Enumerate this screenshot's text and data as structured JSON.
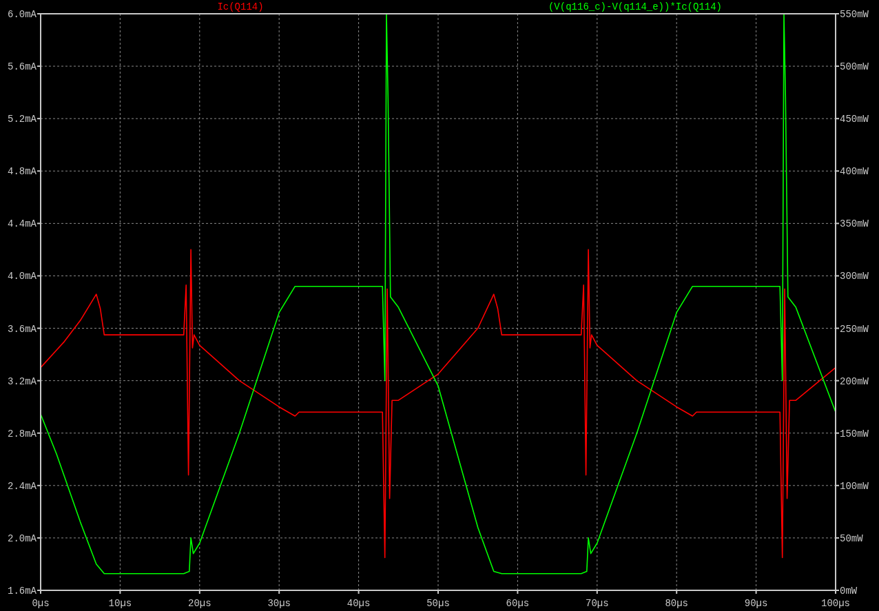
{
  "plot": {
    "charts": [
      {
        "chart_data": {
          "type": "line",
          "grid": true,
          "xlim": [
            0,
            100
          ],
          "ylim": [
            1.6,
            6.0
          ],
          "xticks": [
            {
              "value": 0,
              "label": "0µs"
            },
            {
              "value": 10,
              "label": "10µs"
            },
            {
              "value": 20,
              "label": "20µs"
            },
            {
              "value": 30,
              "label": "30µs"
            },
            {
              "value": 40,
              "label": "40µs"
            },
            {
              "value": 50,
              "label": "50µs"
            },
            {
              "value": 60,
              "label": "60µs"
            },
            {
              "value": 70,
              "label": "70µs"
            },
            {
              "value": 80,
              "label": "80µs"
            },
            {
              "value": 90,
              "label": "90µs"
            },
            {
              "value": 100,
              "label": "100µs"
            }
          ],
          "yticks": [
            {
              "value": 1.6,
              "label": "1.6mA"
            },
            {
              "value": 2.0,
              "label": "2.0mA"
            },
            {
              "value": 2.4,
              "label": "2.4mA"
            },
            {
              "value": 2.8,
              "label": "2.8mA"
            },
            {
              "value": 3.2,
              "label": "3.2mA"
            },
            {
              "value": 3.6,
              "label": "3.6mA"
            },
            {
              "value": 4.0,
              "label": "4.0mA"
            },
            {
              "value": 4.4,
              "label": "4.4mA"
            },
            {
              "value": 4.8,
              "label": "4.8mA"
            },
            {
              "value": 5.2,
              "label": "5.2mA"
            },
            {
              "value": 5.6,
              "label": "5.6mA"
            },
            {
              "value": 6.0,
              "label": "6.0mA"
            }
          ],
          "x": [
            0,
            3,
            5,
            7,
            7.5,
            8,
            10,
            18,
            18.3,
            18.6,
            18.9,
            19.1,
            19.3,
            20,
            25,
            30,
            32,
            32.5,
            40,
            43,
            43.3,
            43.6,
            43.9,
            44.2,
            45,
            50,
            55,
            57,
            57.5,
            58,
            68,
            68.3,
            68.6,
            68.9,
            69.1,
            69.3,
            70,
            75,
            80,
            82,
            82.5,
            90,
            93,
            93.3,
            93.6,
            93.9,
            94.2,
            95,
            100
          ],
          "series": [
            {
              "name": "Ic(Q114)",
              "color": "#ff0000",
              "values": [
                3.3,
                3.5,
                3.66,
                3.86,
                3.75,
                3.55,
                3.55,
                3.55,
                3.93,
                2.48,
                4.2,
                3.45,
                3.55,
                3.47,
                3.2,
                3.0,
                2.93,
                2.96,
                2.96,
                2.96,
                1.85,
                3.9,
                2.3,
                3.05,
                3.05,
                3.25,
                3.6,
                3.86,
                3.75,
                3.55,
                3.55,
                3.93,
                2.48,
                4.2,
                3.45,
                3.55,
                3.47,
                3.2,
                3.0,
                2.93,
                2.96,
                2.96,
                2.96,
                1.85,
                3.9,
                2.3,
                3.05,
                3.05,
                3.3
              ]
            }
          ]
        }
      },
      {
        "chart_data": {
          "type": "line",
          "xlim": [
            0,
            100
          ],
          "ylim": [
            0,
            550
          ],
          "yticks": [
            {
              "value": 0,
              "label": "0mW"
            },
            {
              "value": 50,
              "label": "50mW"
            },
            {
              "value": 100,
              "label": "100mW"
            },
            {
              "value": 150,
              "label": "150mW"
            },
            {
              "value": 200,
              "label": "200mW"
            },
            {
              "value": 250,
              "label": "250mW"
            },
            {
              "value": 300,
              "label": "300mW"
            },
            {
              "value": 350,
              "label": "350mW"
            },
            {
              "value": 400,
              "label": "400mW"
            },
            {
              "value": 450,
              "label": "450mW"
            },
            {
              "value": 500,
              "label": "500mW"
            },
            {
              "value": 550,
              "label": "550mW"
            }
          ],
          "x": [
            0,
            2,
            5,
            7,
            8,
            10,
            18,
            18.7,
            18.9,
            19.2,
            20,
            25,
            30,
            32,
            33,
            43,
            43.3,
            43.5,
            43.7,
            44,
            45,
            50,
            55,
            57,
            58,
            68,
            68.7,
            68.9,
            69.2,
            70,
            75,
            80,
            82,
            83,
            93,
            93.3,
            93.5,
            93.7,
            94,
            95,
            100
          ],
          "series": [
            {
              "name": "(V(q116_c)-V(q114_e))*Ic(Q114)",
              "color": "#00ff00",
              "values": [
                168,
                130,
                65,
                25,
                16,
                16,
                16,
                18,
                50,
                35,
                45,
                150,
                265,
                290,
                290,
                290,
                200,
                550,
                470,
                280,
                270,
                195,
                60,
                18,
                16,
                16,
                18,
                50,
                35,
                45,
                150,
                265,
                290,
                290,
                290,
                200,
                550,
                470,
                280,
                270,
                170
              ]
            }
          ]
        }
      }
    ]
  }
}
